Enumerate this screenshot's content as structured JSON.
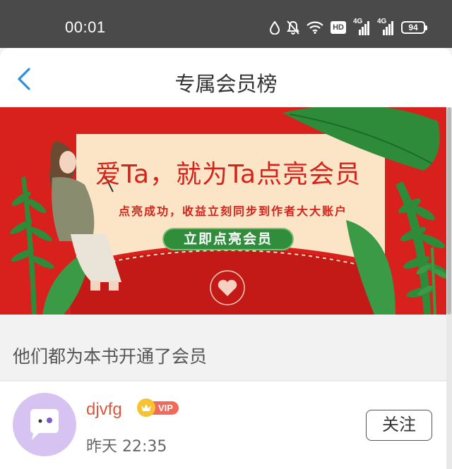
{
  "status_bar": {
    "time": "00:01",
    "hd_label": "HD",
    "net1": "4G",
    "net2": "4G",
    "battery": "94",
    "icons": [
      "water-drop-icon",
      "mute-bell-icon",
      "wifi-icon",
      "hd-icon",
      "signal-icon",
      "signal-icon",
      "battery-icon"
    ]
  },
  "nav": {
    "back_icon": "chevron-left-icon",
    "title": "专属会员榜"
  },
  "banner": {
    "headline": "爱Ta，就为Ta点亮会员",
    "subtitle": "点亮成功，收益立刻同步到作者大大账户",
    "button_label": "立即点亮会员",
    "colors": {
      "background": "#d8211d",
      "card": "#fce4c6",
      "leaf": "#2e8b3a",
      "button": "#2f8d3b"
    }
  },
  "section": {
    "title": "他们都为本书开通了会员"
  },
  "members": [
    {
      "name": "djvfg",
      "badge": "VIP",
      "time": "昨天 22:35",
      "follow_label": "关注",
      "avatar_color": "#d6c3f1",
      "name_color": "#e0563b"
    }
  ]
}
